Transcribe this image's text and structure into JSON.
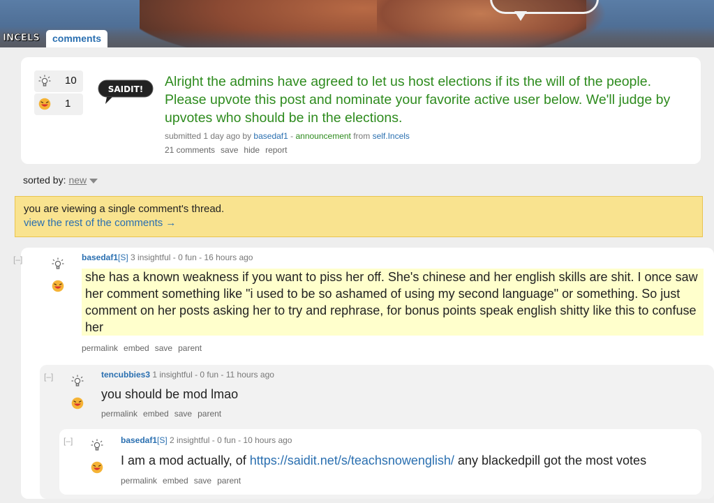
{
  "header": {
    "subreddit": "INCELS",
    "tab_label": "comments"
  },
  "post": {
    "upvotes": "10",
    "funvotes": "1",
    "logo_text": "SAIDIT!",
    "title": "Alright the admins have agreed to let us host elections if its the will of the people. Please upvote this post and nominate your favorite active user below. We'll judge by upvotes who should be in the elections.",
    "tagline": {
      "prefix": "submitted 1 day ago by ",
      "author": "basedaf1",
      "dash": " - ",
      "flair": "announcement",
      "from": " from ",
      "domain": "self.Incels"
    },
    "buttons": [
      "21 comments",
      "save",
      "hide",
      "report"
    ]
  },
  "sort": {
    "label": "sorted by:",
    "value": "new"
  },
  "notice": {
    "text": "you are viewing a single comment's thread.",
    "link": "view the rest of the comments →"
  },
  "comments": [
    {
      "collapse": "[–]",
      "author": "basedaf1",
      "submitter": "[S]",
      "meta": " 3 insightful - 0 fun - 16 hours ago",
      "body": "she has a known weakness if you want to piss her off. She's chinese and her english skills are shit. I once saw her comment something like \"i used to be so ashamed of using my second language\" or something. So just comment on her posts asking her to try and rephrase, for bonus points speak english shitty like this to confuse her",
      "buttons": [
        "permalink",
        "embed",
        "save",
        "parent"
      ]
    },
    {
      "collapse": "[–]",
      "author": "tencubbies3",
      "meta": " 1 insightful - 0 fun - 11 hours ago",
      "body": "you should be mod lmao",
      "buttons": [
        "permalink",
        "embed",
        "save",
        "parent"
      ]
    },
    {
      "collapse": "[–]",
      "author": "basedaf1",
      "submitter": "[S]",
      "meta": " 2 insightful - 0 fun - 10 hours ago",
      "body_prefix": "I am a mod actually, of ",
      "body_link": "https://saidit.net/s/teachsnowenglish/",
      "body_suffix": " any blackedpill got the most votes",
      "buttons": [
        "permalink",
        "embed",
        "save",
        "parent"
      ]
    }
  ],
  "icons": {
    "insightful": "lightbulb-icon",
    "fun": "laughing-face-icon"
  },
  "colors": {
    "title_green": "#2e8b1e",
    "link_blue": "#2a6fb0",
    "notice_bg": "#f9e38f",
    "highlight": "#ffffcc"
  }
}
